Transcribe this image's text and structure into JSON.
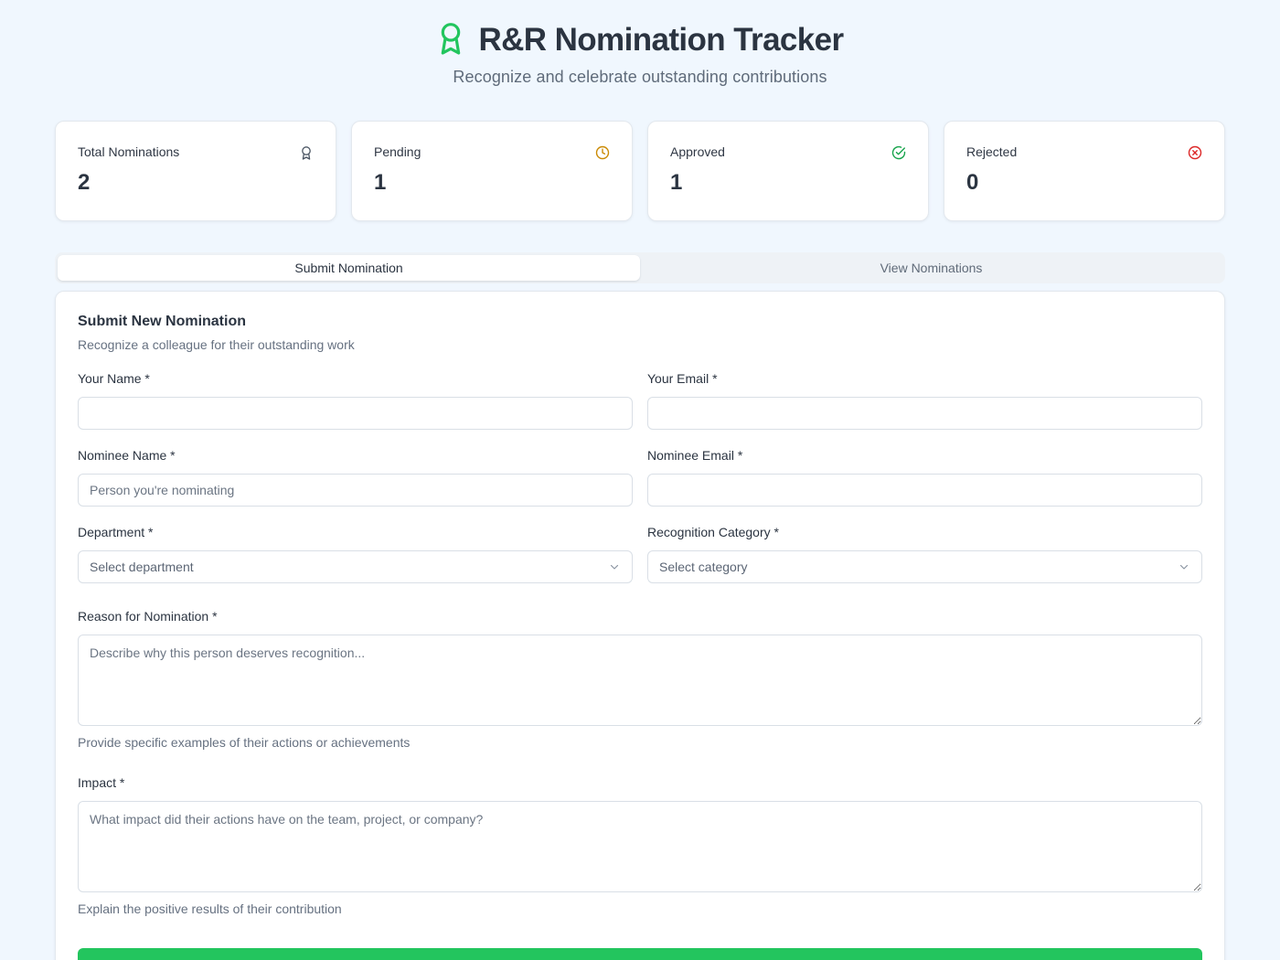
{
  "header": {
    "title": "R&R Nomination Tracker",
    "subtitle": "Recognize and celebrate outstanding contributions",
    "accent_color": "#22c55e",
    "icon": "award-icon"
  },
  "stats": [
    {
      "label": "Total Nominations",
      "value": "2",
      "icon": "award-icon",
      "color": "#4b5563"
    },
    {
      "label": "Pending",
      "value": "1",
      "icon": "clock-icon",
      "color": "#ca8a04"
    },
    {
      "label": "Approved",
      "value": "1",
      "icon": "check-circle-icon",
      "color": "#16a34a"
    },
    {
      "label": "Rejected",
      "value": "0",
      "icon": "x-circle-icon",
      "color": "#dc2626"
    }
  ],
  "tabs": [
    {
      "label": "Submit Nomination",
      "active": true
    },
    {
      "label": "View Nominations",
      "active": false
    }
  ],
  "form": {
    "title": "Submit New Nomination",
    "description": "Recognize a colleague for their outstanding work",
    "your_name": {
      "label": "Your Name *",
      "placeholder": "",
      "value": ""
    },
    "your_email": {
      "label": "Your Email *",
      "placeholder": "",
      "value": ""
    },
    "nominee_name": {
      "label": "Nominee Name *",
      "placeholder": "Person you're nominating",
      "value": ""
    },
    "nominee_email": {
      "label": "Nominee Email *",
      "placeholder": "",
      "value": ""
    },
    "department": {
      "label": "Department *",
      "selected": "Select department"
    },
    "category": {
      "label": "Recognition Category *",
      "selected": "Select category"
    },
    "reason": {
      "label": "Reason for Nomination *",
      "placeholder": "Describe why this person deserves recognition...",
      "hint": "Provide specific examples of their actions or achievements"
    },
    "impact": {
      "label": "Impact *",
      "placeholder": "What impact did their actions have on the team, project, or company?",
      "hint": "Explain the positive results of their contribution"
    },
    "submit_color": "#22c55e"
  }
}
